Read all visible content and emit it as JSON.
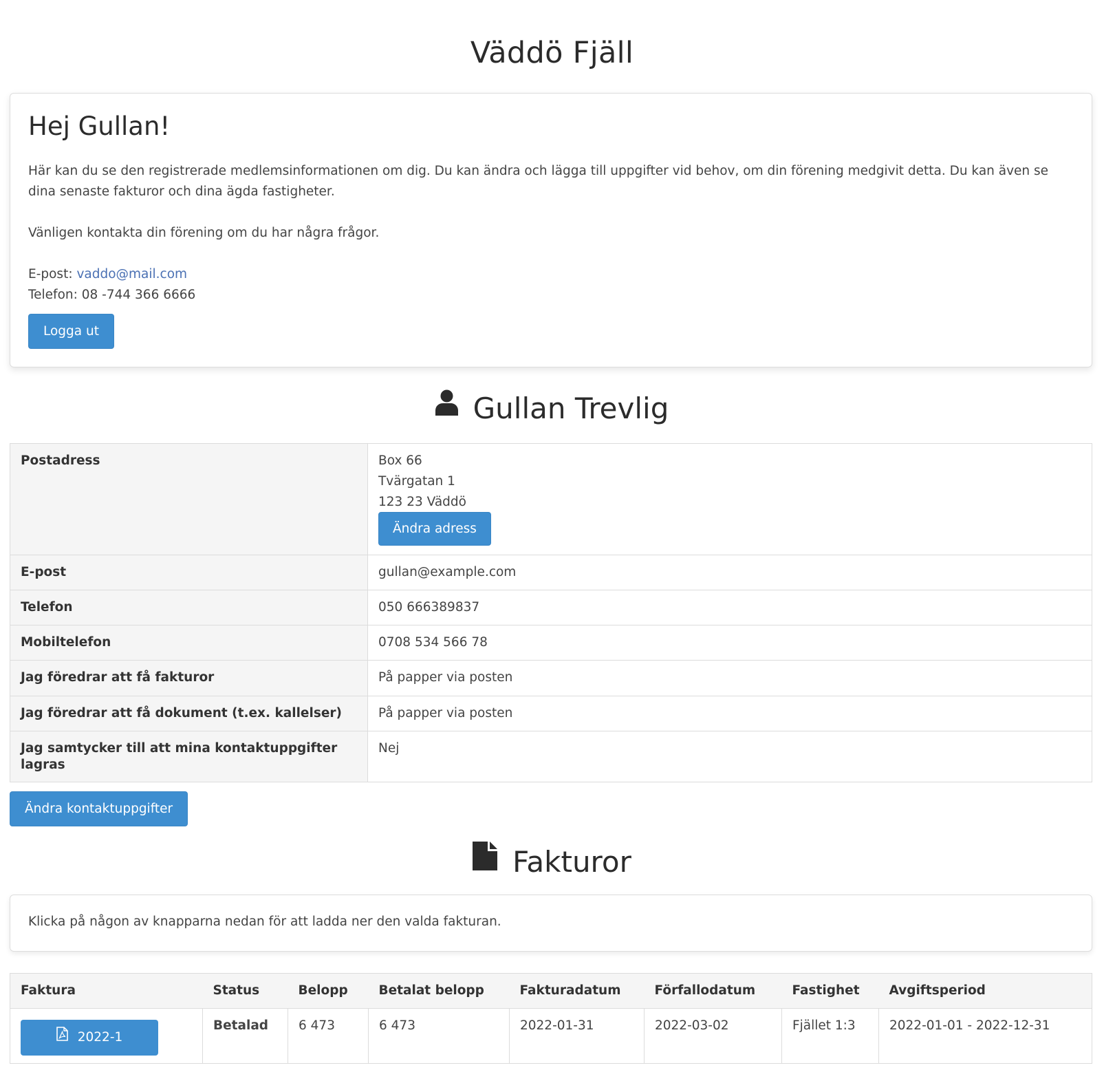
{
  "site": {
    "title": "Väddö Fjäll"
  },
  "welcome": {
    "heading": "Hej Gullan!",
    "intro": "Här kan du se den registrerade medlemsinformationen om dig. Du kan ändra och lägga till uppgifter vid behov, om din förening medgivit detta. Du kan även se dina senaste fakturor och dina ägda fastigheter.",
    "contact_prompt": "Vänligen kontakta din förening om du har några frågor.",
    "email_label": "E-post: ",
    "email": "vaddo@mail.com",
    "phone_label": "Telefon: ",
    "phone": "08 -744 366 6666",
    "logout_label": "Logga ut"
  },
  "member": {
    "name": "Gullan Trevlig",
    "icon": "user-icon",
    "rows": [
      {
        "label": "Postadress",
        "address": [
          "Box 66",
          "Tvärgatan 1",
          "123 23 Väddö"
        ],
        "button": "Ändra adress"
      },
      {
        "label": "E-post",
        "value": "gullan@example.com"
      },
      {
        "label": "Telefon",
        "value": "050 666389837"
      },
      {
        "label": "Mobiltelefon",
        "value": "0708 534 566 78"
      },
      {
        "label": "Jag föredrar att få fakturor",
        "value": "På papper via posten"
      },
      {
        "label": "Jag föredrar att få dokument (t.ex. kallelser)",
        "value": "På papper via posten"
      },
      {
        "label": "Jag samtycker till att mina kontaktuppgifter lagras",
        "value": "Nej"
      }
    ],
    "edit_button": "Ändra kontaktuppgifter"
  },
  "invoices": {
    "heading": "Fakturor",
    "icon": "file-icon",
    "note": "Klicka på någon av knapparna nedan för att ladda ner den valda fakturan.",
    "columns": [
      "Faktura",
      "Status",
      "Belopp",
      "Betalat belopp",
      "Fakturadatum",
      "Förfallodatum",
      "Fastighet",
      "Avgiftsperiod"
    ],
    "rows": [
      {
        "invoice": "2022-1",
        "status": "Betalad",
        "amount": "6 473",
        "paid": "6 473",
        "invoice_date": "2022-01-31",
        "due_date": "2022-03-02",
        "property": "Fjället 1:3",
        "period": "2022-01-01 - 2022-12-31"
      }
    ]
  },
  "colors": {
    "primary": "#3e8ed0",
    "link": "#4a70b3",
    "paid": "#8cc045"
  }
}
